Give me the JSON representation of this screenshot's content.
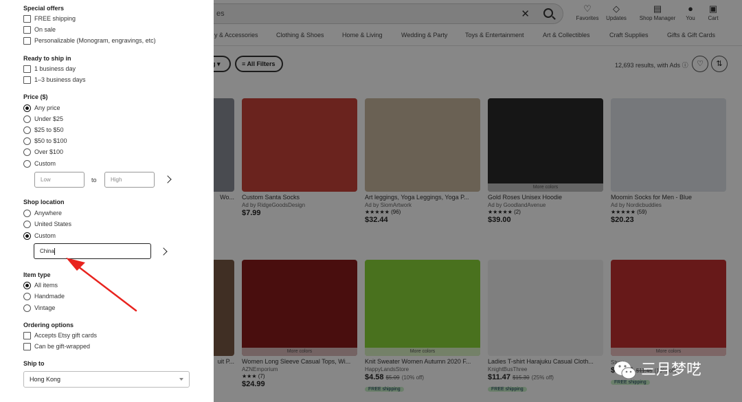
{
  "header": {
    "search_query": "es",
    "icons": [
      {
        "name": "favorites",
        "label": "Favorites",
        "glyph": "♡"
      },
      {
        "name": "updates",
        "label": "Updates",
        "glyph": "🔔"
      },
      {
        "name": "shop-manager",
        "label": "Shop Manager",
        "glyph": "▤"
      },
      {
        "name": "you",
        "label": "You",
        "glyph": "●"
      },
      {
        "name": "cart",
        "label": "Cart",
        "glyph": "🛒"
      }
    ]
  },
  "categories": [
    "y & Accessories",
    "Clothing & Shoes",
    "Home & Living",
    "Wedding & Party",
    "Toys & Entertainment",
    "Art & Collectibles",
    "Craft Supplies",
    "Gifts & Gift Cards"
  ],
  "toolbar": {
    "sort_fragment": "g",
    "all_filters_label": "All Filters",
    "results_text": "12,693 results, with Ads",
    "info_glyph": "ⓘ"
  },
  "products_row1": [
    {
      "title": "Wo...",
      "seller": "",
      "rating": "",
      "reviews": "",
      "price": "",
      "color": "#8a8f98"
    },
    {
      "title": "Custom Santa Socks",
      "seller": "Ad by RidgeGoodsDesign",
      "rating": "",
      "reviews": "",
      "price": "$7.99",
      "color": "#c8423a"
    },
    {
      "title": "Art leggings, Yoga Leggings, Yoga P...",
      "seller": "Ad by SiomArtwork",
      "rating": "★★★★★",
      "reviews": "(96)",
      "price": "$32.44",
      "color": "#c9b89f"
    },
    {
      "title": "Gold Roses Unisex Hoodie",
      "seller": "Ad by GoodlandAvenue",
      "rating": "★★★★★",
      "reviews": "(2)",
      "price": "$39.00",
      "tag": "More colors",
      "color": "#2a2a2a"
    },
    {
      "title": "Moomin Socks for Men - Blue",
      "seller": "Ad by Nordicbuddies",
      "rating": "★★★★★",
      "reviews": "(59)",
      "price": "$20.23",
      "color": "#dfe3e8"
    }
  ],
  "products_row2": [
    {
      "title": "uit P...",
      "seller": "",
      "rating": "",
      "reviews": "",
      "price": "",
      "color": "#7a5a45"
    },
    {
      "title": "Women Long Sleeve Casual Tops, Wi...",
      "seller": "AZNEmporium",
      "rating": "★★★",
      "reviews": "(7)",
      "price": "$24.99",
      "tag": "More colors",
      "color": "#8b1c1c"
    },
    {
      "title": "Knit Sweater Women Autumn 2020 F...",
      "seller": "HappyLandsStore",
      "rating": "",
      "reviews": "",
      "price": "$4.58",
      "old_price": "$5.09",
      "discount": "(10% off)",
      "free_shipping": "FREE shipping",
      "tag": "More colors",
      "color": "#8bd63a"
    },
    {
      "title": "Ladies T-shirt Harajuku Casual Cloth...",
      "seller": "KnightBusThree",
      "rating": "",
      "reviews": "",
      "price": "$11.47",
      "old_price": "$15.30",
      "discount": "(25% off)",
      "free_shipping": "FREE shipping",
      "color": "#f0f0f0"
    },
    {
      "title": "",
      "seller": "Strav...",
      "rating": "",
      "reviews": "",
      "price": "$10.31",
      "old_price": "$11.45",
      "discount": "(10% off)",
      "free_shipping": "FREE shipping",
      "tag": "More colors",
      "color": "#c23030"
    }
  ],
  "filters": {
    "special_offers": {
      "title": "Special offers",
      "options": [
        "FREE shipping",
        "On sale",
        "Personalizable (Monogram, engravings, etc)"
      ]
    },
    "ready_to_ship": {
      "title": "Ready to ship in",
      "options": [
        "1 business day",
        "1–3 business days"
      ]
    },
    "price": {
      "title": "Price ($)",
      "options": [
        "Any price",
        "Under $25",
        "$25 to $50",
        "$50 to $100",
        "Over $100",
        "Custom"
      ],
      "selected": "Any price",
      "low_placeholder": "Low",
      "high_placeholder": "High",
      "to_label": "to"
    },
    "shop_location": {
      "title": "Shop location",
      "options": [
        "Anywhere",
        "United States",
        "Custom"
      ],
      "selected": "Custom",
      "custom_value": "China"
    },
    "item_type": {
      "title": "Item type",
      "options": [
        "All items",
        "Handmade",
        "Vintage"
      ],
      "selected": "All items"
    },
    "ordering": {
      "title": "Ordering options",
      "options": [
        "Accepts Etsy gift cards",
        "Can be gift-wrapped"
      ]
    },
    "ship_to": {
      "title": "Ship to",
      "value": "Hong Kong"
    }
  },
  "watermark": {
    "text": "三月梦呓"
  },
  "colors": {
    "overlay": "rgba(0,0,0,0.47)",
    "annotation_arrow": "#e8231e"
  }
}
